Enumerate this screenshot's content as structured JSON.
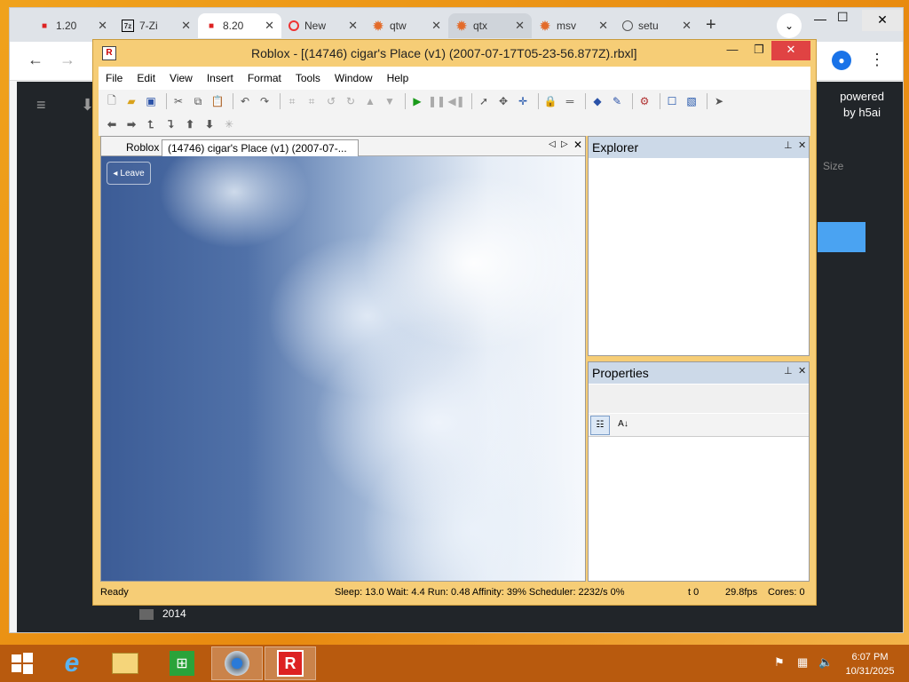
{
  "browser": {
    "tabs": [
      {
        "label": "1.20",
        "icon": "red-square-icon"
      },
      {
        "label": "7-Zi",
        "icon": "7zip-icon"
      },
      {
        "label": "8.20",
        "icon": "red-square-icon"
      },
      {
        "label": "New",
        "icon": "opera-icon"
      },
      {
        "label": "qtw",
        "icon": "qt-icon"
      },
      {
        "label": "qtx",
        "icon": "qt-icon"
      },
      {
        "label": "msv",
        "icon": "qt-icon"
      },
      {
        "label": "setu",
        "icon": "globe-icon"
      }
    ],
    "page": {
      "powered_by": "powered by h5ai",
      "size_header": "Size",
      "folder_2014": "2014"
    }
  },
  "roblox": {
    "title": "Roblox - [(14746) cigar's Place (v1) (2007-07-17T05-23-56.877Z).rbxl]",
    "menu": [
      "File",
      "Edit",
      "View",
      "Insert",
      "Format",
      "Tools",
      "Window",
      "Help"
    ],
    "doc_tabs": {
      "inactive": "Roblox",
      "active": "(14746) cigar's Place (v1) (2007-07-..."
    },
    "leave_label": "Leave",
    "explorer_title": "Explorer",
    "properties_title": "Properties",
    "status": {
      "ready": "Ready",
      "stats": "Sleep: 13.0 Wait: 4.4 Run: 0.48 Affinity: 39% Scheduler: 2232/s 0%",
      "t": "t 0",
      "fps": "29.8fps",
      "cores": "Cores: 0"
    }
  },
  "taskbar": {
    "time": "6:07 PM",
    "date": "10/31/2025"
  },
  "colors": {
    "desktop": "#ef9a1c",
    "roblox_frame": "#f6cd76",
    "panel_header": "#ccd9e8",
    "close_red": "#e04343"
  }
}
